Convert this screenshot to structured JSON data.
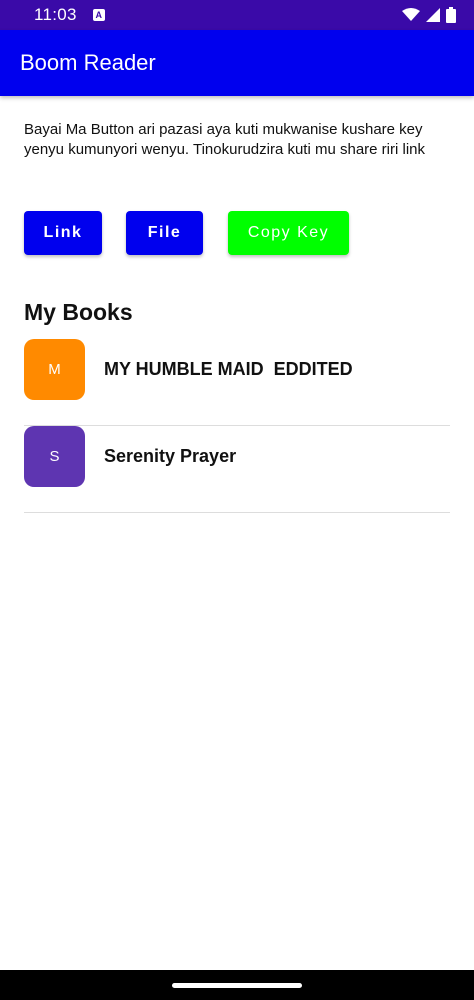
{
  "status_bar": {
    "time": "11:03",
    "notification_icon": "A",
    "icons": [
      "wifi-icon",
      "signal-icon",
      "battery-icon"
    ]
  },
  "app_bar": {
    "title": "Boom Reader",
    "color": "#0000ee"
  },
  "instructions": "Bayai Ma Button ari pazasi aya kuti mukwanise  kushare key yenyu kumunyori wenyu. Tinokurudzira kuti mu share riri link",
  "buttons": {
    "link": "Link",
    "file": "File",
    "copy_key": "Copy Key"
  },
  "books_section": {
    "title": "My Books",
    "items": [
      {
        "letter": "M",
        "title": "MY HUMBLE MAID  EDDITED",
        "color": "#ff8a00"
      },
      {
        "letter": "S",
        "title": "Serenity Prayer",
        "color": "#5e35b1"
      }
    ]
  }
}
